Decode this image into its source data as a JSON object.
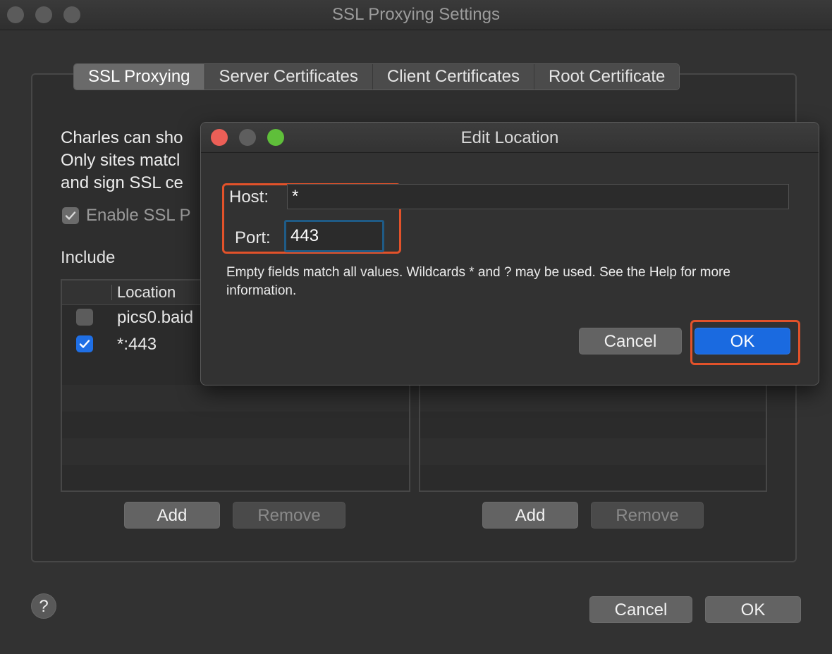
{
  "window": {
    "title": "SSL Proxying Settings",
    "tabs": [
      {
        "label": "SSL Proxying",
        "active": true
      },
      {
        "label": "Server Certificates",
        "active": false
      },
      {
        "label": "Client Certificates",
        "active": false
      },
      {
        "label": "Root Certificate",
        "active": false
      }
    ],
    "description": "Charles can sho\nOnly sites matcl\nand sign SSL ce",
    "enable_label": "Enable SSL P",
    "enable_checked": true,
    "include_label": "Include",
    "include_list": {
      "header": "Location",
      "rows": [
        {
          "checked": false,
          "location": "pics0.baid"
        },
        {
          "checked": true,
          "location": "*:443"
        }
      ]
    },
    "include_buttons": {
      "add": "Add",
      "remove": "Remove"
    },
    "exclude_buttons": {
      "add": "Add",
      "remove": "Remove"
    },
    "help_label": "?",
    "cancel_label": "Cancel",
    "ok_label": "OK"
  },
  "dialog": {
    "title": "Edit Location",
    "host_label": "Host:",
    "host_value": "*",
    "port_label": "Port:",
    "port_value": "443",
    "help_text": "Empty fields match all values. Wildcards * and ? may be used. See the Help for more information.",
    "cancel_label": "Cancel",
    "ok_label": "OK"
  },
  "colors": {
    "accent": "#1a6ae0",
    "highlight": "#e2522a",
    "close": "#ec5f57",
    "zoom": "#5fbf3a"
  }
}
